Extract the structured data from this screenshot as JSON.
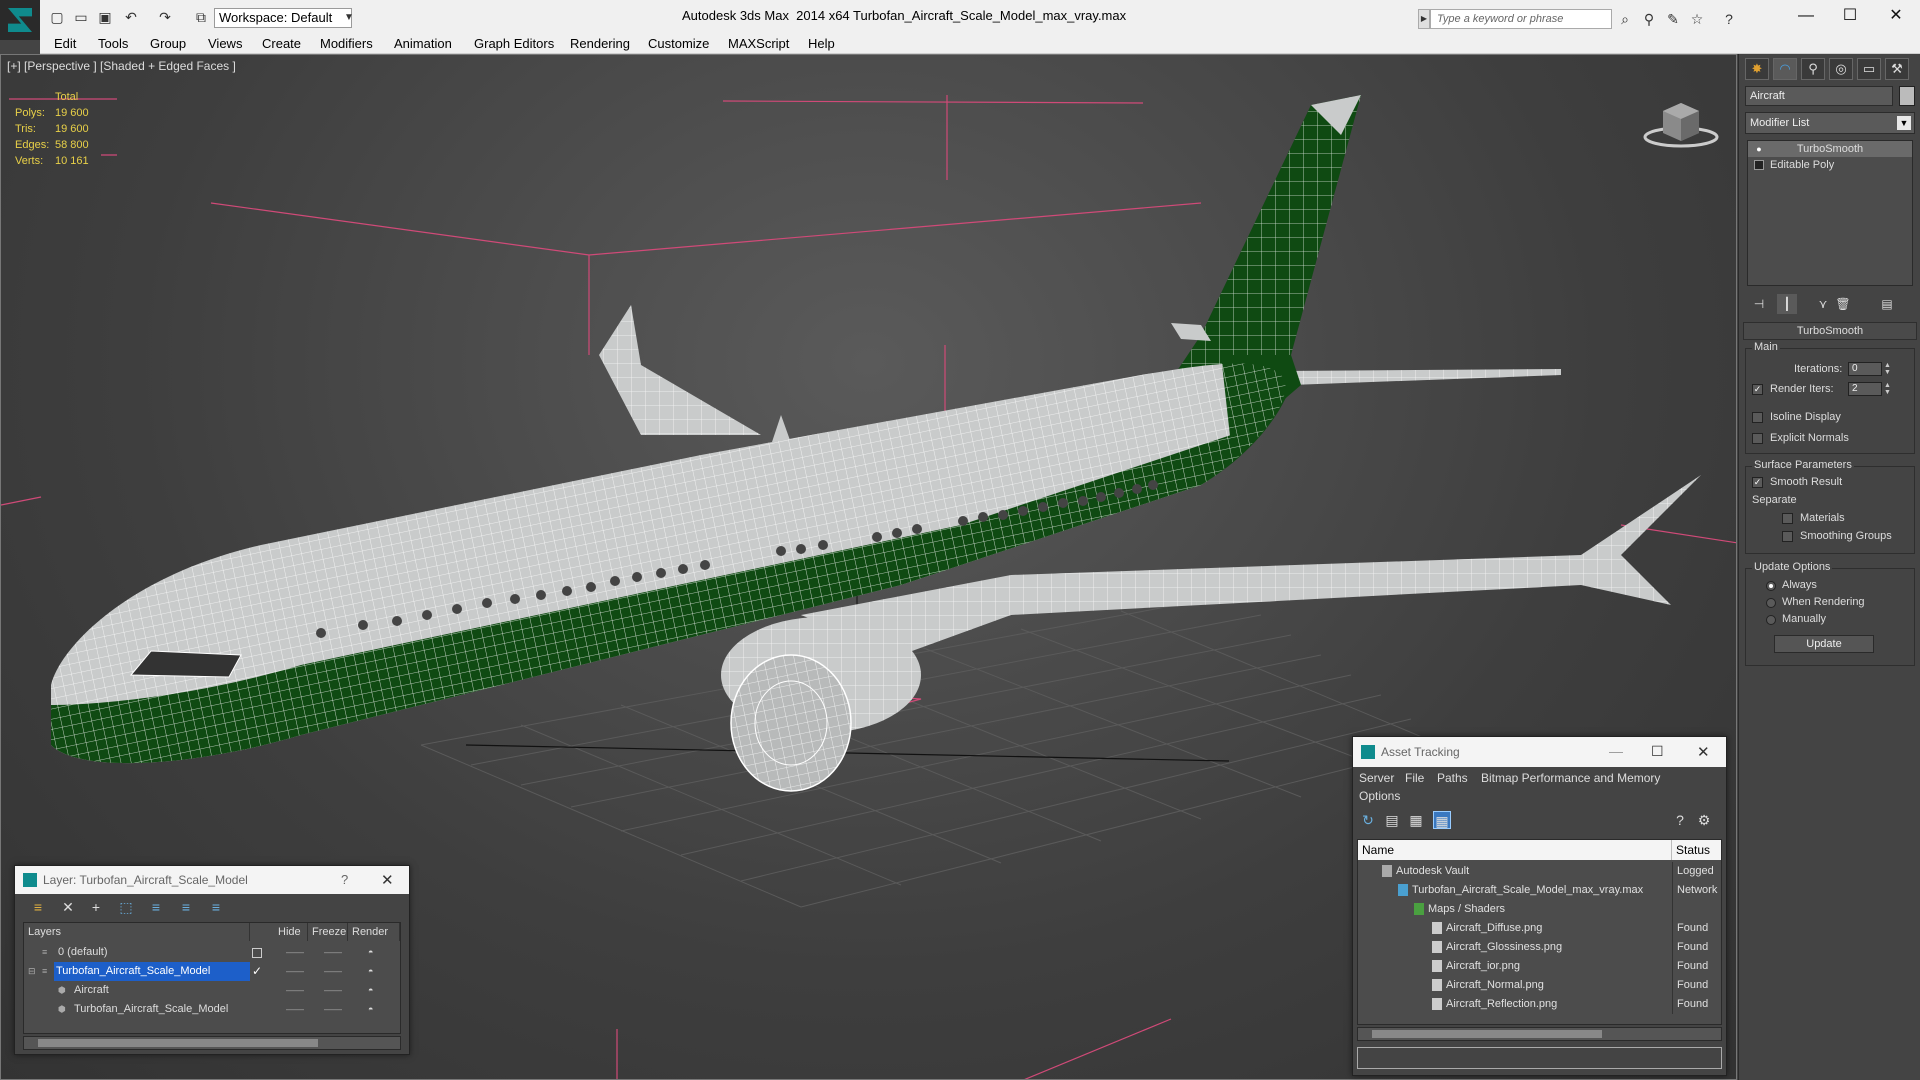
{
  "titlebar": {
    "workspace": "Workspace: Default",
    "app_title": "Autodesk 3ds Max  2014 x64",
    "file_title": "Turbofan_Aircraft_Scale_Model_max_vray.max",
    "search_placeholder": "Type a keyword or phrase"
  },
  "menu": [
    "Edit",
    "Tools",
    "Group",
    "Views",
    "Create",
    "Modifiers",
    "Animation",
    "Graph Editors",
    "Rendering",
    "Customize",
    "MAXScript",
    "Help"
  ],
  "viewport": {
    "label": "[+] [Perspective ] [Shaded + Edged Faces ]",
    "stats": {
      "header": "Total",
      "rows": [
        {
          "k": "Polys:",
          "v": "19 600"
        },
        {
          "k": "Tris:",
          "v": "19 600"
        },
        {
          "k": "Edges:",
          "v": "58 800"
        },
        {
          "k": "Verts:",
          "v": "10 161"
        }
      ]
    }
  },
  "command_panel": {
    "object_name": "Aircraft",
    "modifier_list": "Modifier List",
    "stack": [
      "TurboSmooth",
      "Editable Poly"
    ],
    "turbosmooth": {
      "title": "TurboSmooth",
      "main": "Main",
      "iterations_label": "Iterations:",
      "iterations": "0",
      "render_iters_label": "Render Iters:",
      "render_iters": "2",
      "isoline": "Isoline Display",
      "explicit": "Explicit Normals",
      "surface": "Surface Parameters",
      "smooth_result": "Smooth Result",
      "separate": "Separate",
      "materials": "Materials",
      "smoothing_groups": "Smoothing Groups",
      "update_options": "Update Options",
      "always": "Always",
      "when_rendering": "When Rendering",
      "manually": "Manually",
      "update": "Update"
    }
  },
  "layer_dialog": {
    "title": "Layer: Turbofan_Aircraft_Scale_Model",
    "help": "?",
    "columns": [
      "Layers",
      "Hide",
      "Freeze",
      "Render"
    ],
    "rows": [
      {
        "name": "0 (default)"
      },
      {
        "name": "Turbofan_Aircraft_Scale_Model"
      },
      {
        "name": "Aircraft"
      },
      {
        "name": "Turbofan_Aircraft_Scale_Model"
      }
    ]
  },
  "asset_dialog": {
    "title": "Asset Tracking",
    "menu": [
      "Server",
      "File",
      "Paths",
      "Bitmap Performance and Memory",
      "Options"
    ],
    "columns": [
      "Name",
      "Status"
    ],
    "rows": [
      {
        "name": "Autodesk Vault",
        "status": "Logged O"
      },
      {
        "name": "Turbofan_Aircraft_Scale_Model_max_vray.max",
        "status": "Network"
      },
      {
        "name": "Maps / Shaders",
        "status": ""
      },
      {
        "name": "Aircraft_Diffuse.png",
        "status": "Found"
      },
      {
        "name": "Aircraft_Glossiness.png",
        "status": "Found"
      },
      {
        "name": "Aircraft_ior.png",
        "status": "Found"
      },
      {
        "name": "Aircraft_Normal.png",
        "status": "Found"
      },
      {
        "name": "Aircraft_Reflection.png",
        "status": "Found"
      }
    ]
  },
  "colors": {
    "livery_green": "#0f4a12",
    "fuselage": "#c9cbcb",
    "stats_yellow": "#e8d048",
    "selection_blue": "#1d5fc9"
  }
}
